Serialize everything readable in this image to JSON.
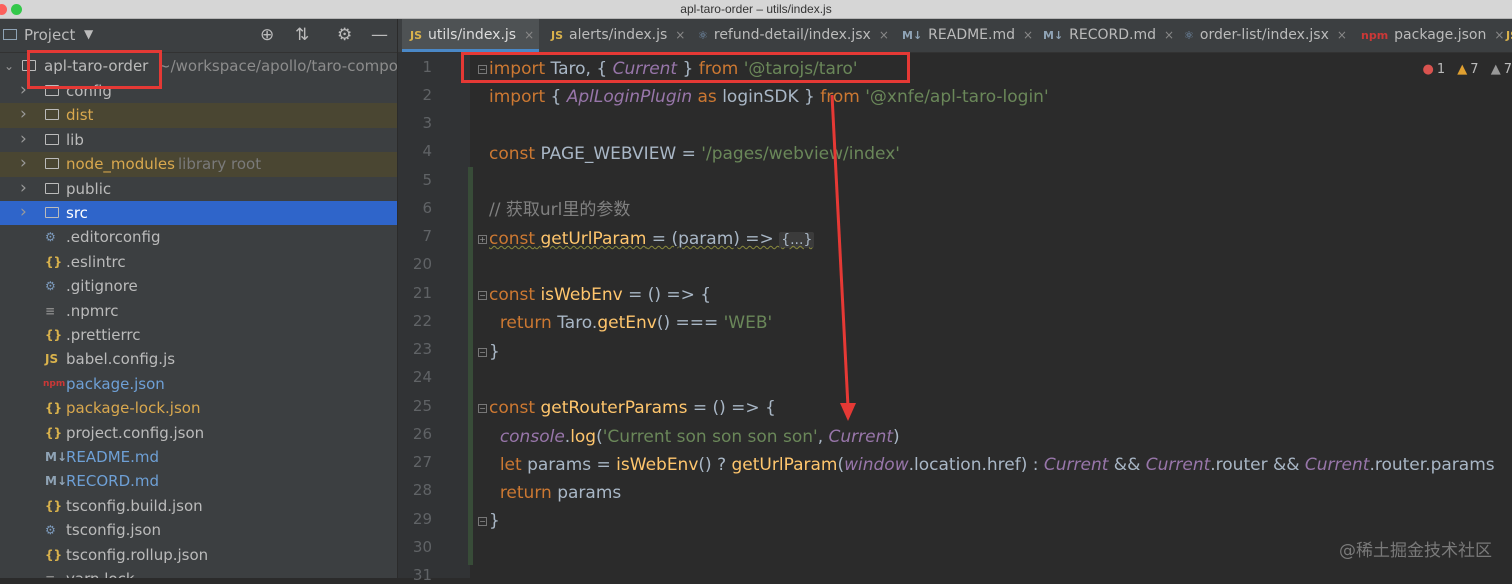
{
  "window": {
    "title": "apl-taro-order – utils/index.js"
  },
  "sidebar": {
    "header_label": "Project",
    "root": {
      "name": "apl-taro-order",
      "path": "~/workspace/apollo/taro-compon"
    },
    "items": [
      {
        "label": "config",
        "type": "folder",
        "icon": "folder-icon"
      },
      {
        "label": "dist",
        "type": "folder",
        "icon": "folder-icon"
      },
      {
        "label": "lib",
        "type": "folder",
        "icon": "folder-icon"
      },
      {
        "label": "node_modules",
        "note": "library root",
        "type": "folder",
        "icon": "folder-icon"
      },
      {
        "label": "public",
        "type": "folder",
        "icon": "folder-icon"
      },
      {
        "label": "src",
        "type": "folder",
        "icon": "folder-icon"
      },
      {
        "label": ".editorconfig",
        "type": "file",
        "icon": "gear-icon"
      },
      {
        "label": ".eslintrc",
        "type": "file",
        "icon": "json-icon"
      },
      {
        "label": ".gitignore",
        "type": "file",
        "icon": "gear-icon"
      },
      {
        "label": ".npmrc",
        "type": "file",
        "icon": "text-file-icon"
      },
      {
        "label": ".prettierrc",
        "type": "file",
        "icon": "json-icon"
      },
      {
        "label": "babel.config.js",
        "type": "file",
        "icon": "js-icon"
      },
      {
        "label": "package.json",
        "type": "file",
        "icon": "npm-icon"
      },
      {
        "label": "package-lock.json",
        "type": "file",
        "icon": "json-icon"
      },
      {
        "label": "project.config.json",
        "type": "file",
        "icon": "json-icon"
      },
      {
        "label": "README.md",
        "type": "file",
        "icon": "markdown-icon"
      },
      {
        "label": "RECORD.md",
        "type": "file",
        "icon": "markdown-icon"
      },
      {
        "label": "tsconfig.build.json",
        "type": "file",
        "icon": "json-icon"
      },
      {
        "label": "tsconfig.json",
        "type": "file",
        "icon": "gear-icon"
      },
      {
        "label": "tsconfig.rollup.json",
        "type": "file",
        "icon": "json-icon"
      },
      {
        "label": "yarn.lock",
        "type": "file",
        "icon": "text-file-icon"
      }
    ]
  },
  "tabs": [
    {
      "label": "utils/index.js",
      "icon": "JS",
      "active": true
    },
    {
      "label": "alerts/index.js",
      "icon": "JS"
    },
    {
      "label": "refund-detail/index.jsx",
      "icon": "⚛"
    },
    {
      "label": "README.md",
      "icon": "M↓"
    },
    {
      "label": "RECORD.md",
      "icon": "M↓"
    },
    {
      "label": "order-list/index.jsx",
      "icon": "⚛"
    },
    {
      "label": "package.json",
      "icon": "npm"
    },
    {
      "label": "",
      "icon": "JS"
    }
  ],
  "inspections": {
    "errors": "1",
    "warnings": "7",
    "weak_warnings": "7"
  },
  "gutter_lines": [
    "1",
    "2",
    "3",
    "4",
    "5",
    "6",
    "7",
    "20",
    "21",
    "22",
    "23",
    "24",
    "25",
    "26",
    "27",
    "28",
    "29",
    "30",
    "31"
  ],
  "code": {
    "l1": {
      "kw1": "import",
      "t1": " Taro, { ",
      "it1": "Current",
      "t2": " } ",
      "kw2": "from",
      "t3": " ",
      "str1": "'@tarojs/taro'"
    },
    "l2": {
      "kw1": "import",
      "t1": " { ",
      "it1": "AplLoginPlugin",
      "t2": " ",
      "kw2": "as",
      "t3": " loginSDK } ",
      "kw3": "from",
      "t4": " ",
      "str1": "'@xnfe/apl-taro-login'"
    },
    "l4": {
      "kw1": "const",
      "t1": " PAGE_WEBVIEW = ",
      "str1": "'/pages/webview/index'"
    },
    "l6": {
      "cm1": "// 获取url里的参数"
    },
    "l7": {
      "kw1": "const",
      "t1": " ",
      "fn1": "getUrlParam",
      "t2": " = (param) => ",
      "fold": "{...}"
    },
    "l21": {
      "kw1": "const",
      "t1": " ",
      "fn1": "isWebEnv",
      "t2": " = () => {"
    },
    "l22": {
      "kw1": "return",
      "t1": " Taro.",
      "fn1": "getEnv",
      "t2": "() === ",
      "str1": "'WEB'"
    },
    "l23": {
      "t1": "}"
    },
    "l25": {
      "kw1": "const",
      "t1": " ",
      "fn1": "getRouterParams",
      "t2": " = () => {"
    },
    "l26": {
      "it1": "console",
      "t1": ".",
      "fn1": "log",
      "t2": "(",
      "str1": "'Current son son son son'",
      "t3": ", ",
      "it2": "Current",
      "t4": ")"
    },
    "l27": {
      "kw1": "let",
      "t1": " params = ",
      "fn1": "isWebEnv",
      "t2": "() ? ",
      "fn2": "getUrlParam",
      "t3": "(",
      "it1": "window",
      "t4": ".location.href) : ",
      "it2": "Current",
      "t5": " && ",
      "it3": "Current",
      "t6": ".router && ",
      "it4": "Current",
      "t7": ".router.params"
    },
    "l28": {
      "kw1": "return",
      "t1": " params"
    },
    "l29": {
      "t1": "}"
    }
  },
  "watermark": "@稀土掘金技术社区",
  "colors": {
    "annotation": "#e53935",
    "selection": "#2f65ca",
    "keyword": "#cc7832",
    "string": "#6a8759",
    "italic_ref": "#9876aa",
    "function": "#ffc66d"
  }
}
